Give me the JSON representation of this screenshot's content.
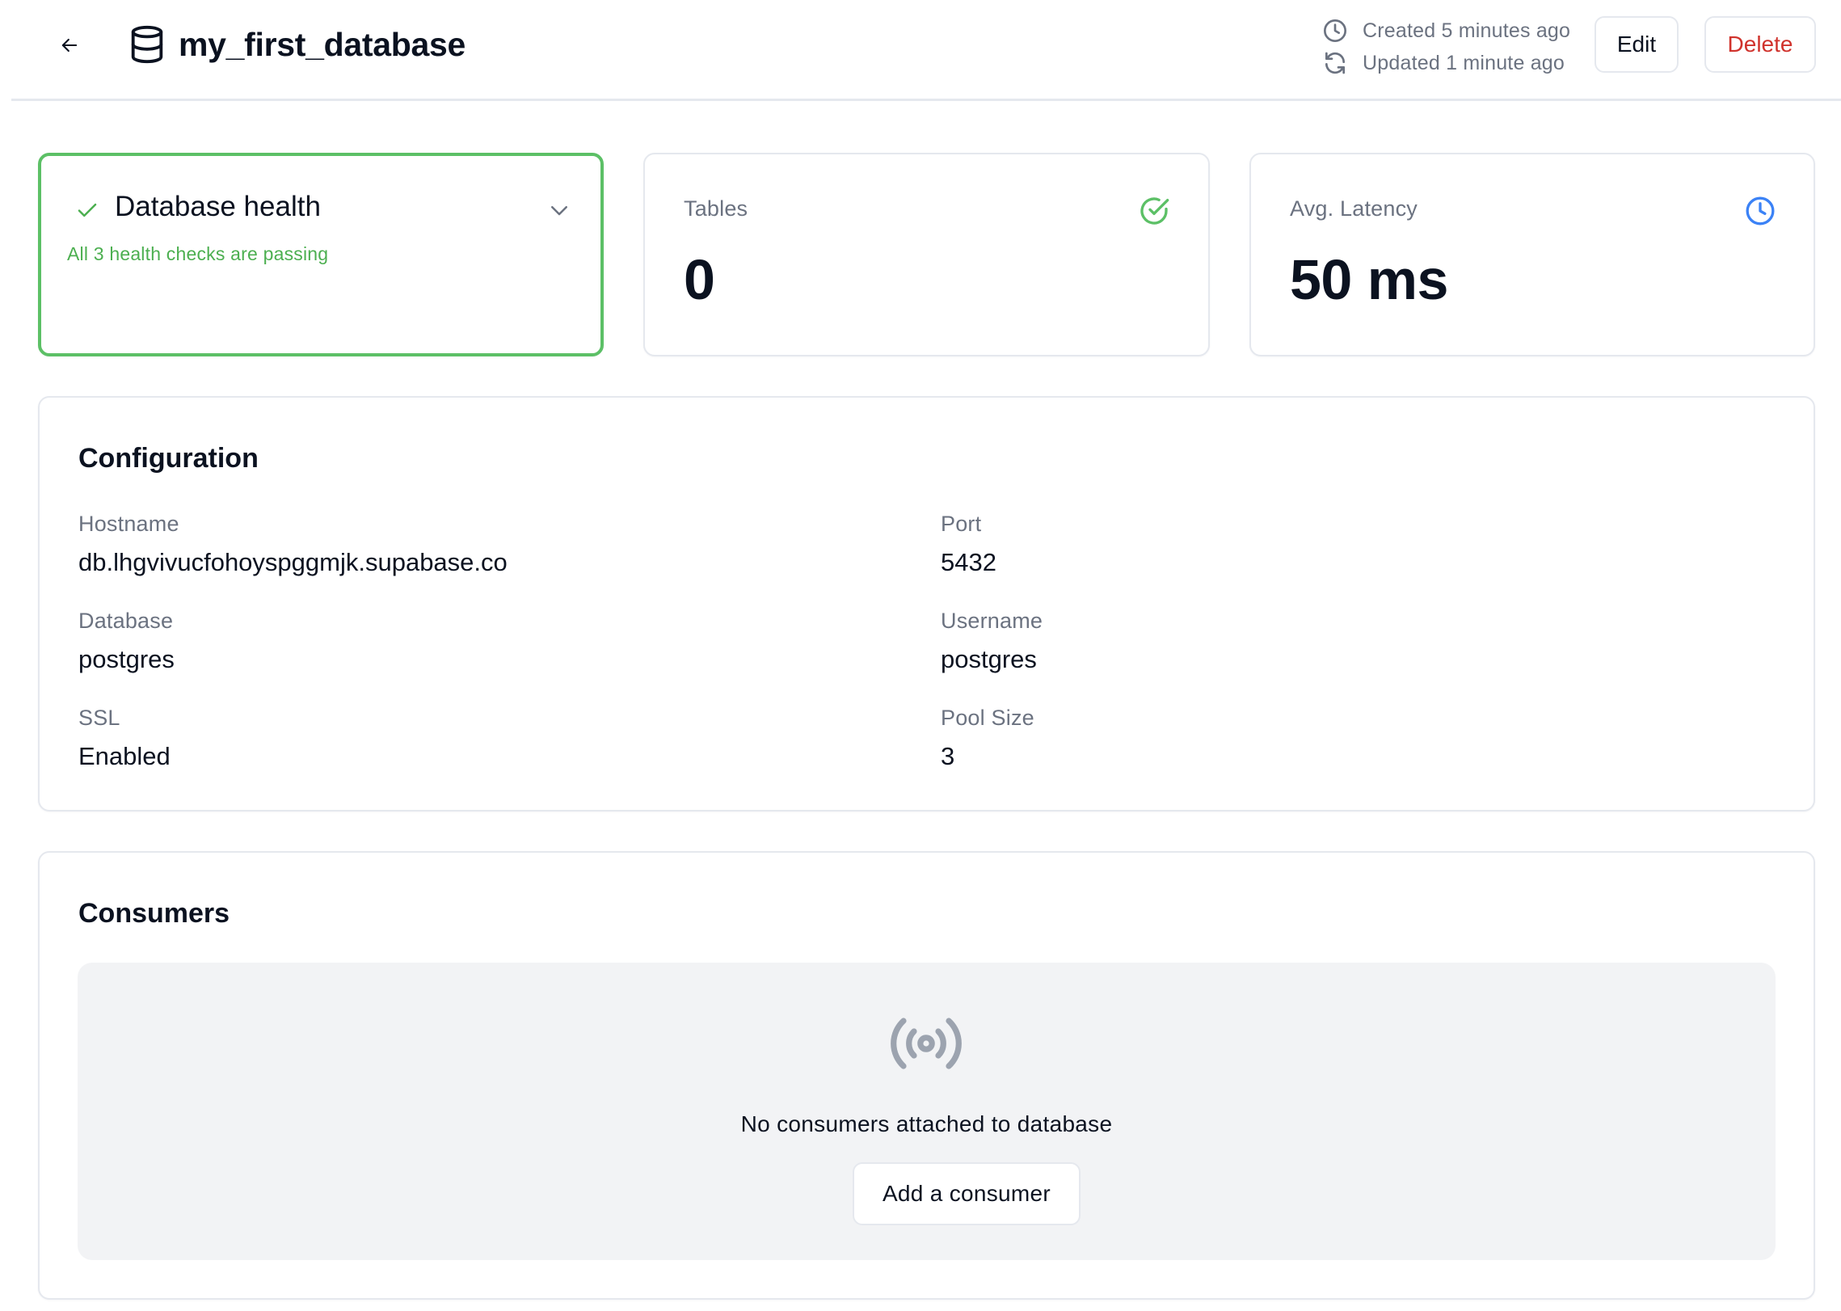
{
  "header": {
    "title": "my_first_database",
    "back_icon": "arrow-left-icon",
    "title_icon": "database-icon",
    "created": "Created 5 minutes ago",
    "updated": "Updated 1 minute ago",
    "edit_label": "Edit",
    "delete_label": "Delete"
  },
  "health": {
    "title": "Database health",
    "status_text": "All 3 health checks are passing",
    "status_icon": "check-icon",
    "accent": "#5cc066"
  },
  "stats": {
    "tables": {
      "label": "Tables",
      "value": "0",
      "icon": "check-circle-icon",
      "icon_color": "#5cc066"
    },
    "latency": {
      "label": "Avg. Latency",
      "value": "50 ms",
      "icon": "clock-icon",
      "icon_color": "#3b82f6"
    }
  },
  "configuration": {
    "title": "Configuration",
    "fields": [
      {
        "label": "Hostname",
        "value": "db.lhgvivucfohoyspggmjk.supabase.co"
      },
      {
        "label": "Port",
        "value": "5432"
      },
      {
        "label": "Database",
        "value": "postgres"
      },
      {
        "label": "Username",
        "value": "postgres"
      },
      {
        "label": "SSL",
        "value": "Enabled"
      },
      {
        "label": "Pool Size",
        "value": "3"
      }
    ]
  },
  "consumers": {
    "title": "Consumers",
    "empty_icon": "broadcast-icon",
    "empty_text": "No consumers attached to database",
    "add_label": "Add a consumer"
  },
  "colors": {
    "danger": "#d0322c",
    "muted_text": "#6b7280",
    "border": "#e5e8ee"
  }
}
